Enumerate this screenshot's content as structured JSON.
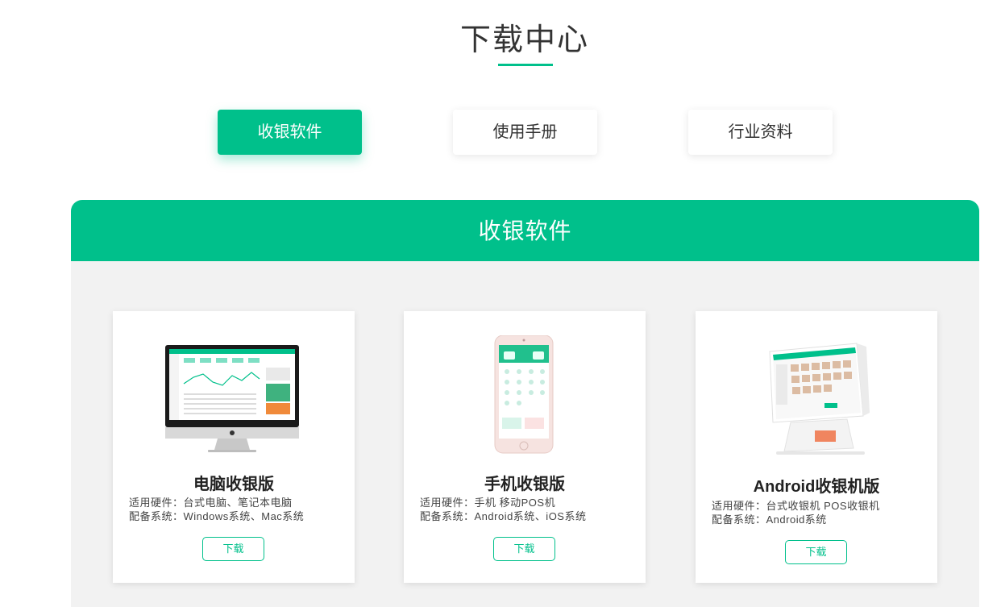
{
  "page_title": "下载中心",
  "tabs": [
    {
      "label": "收银软件",
      "active": true
    },
    {
      "label": "使用手册",
      "active": false
    },
    {
      "label": "行业资料",
      "active": false
    }
  ],
  "panel": {
    "title": "收银软件",
    "cards": [
      {
        "title": "电脑收银版",
        "hardware": "适用硬件：台式电脑、笔记本电脑",
        "system": "配备系统：Windows系统、Mac系统",
        "button": "下载",
        "image": "desktop-computer-illustration"
      },
      {
        "title": "手机收银版",
        "hardware": "适用硬件：手机 移动POS机",
        "system": "配备系统：Android系统、iOS系统",
        "button": "下载",
        "image": "mobile-phone-illustration"
      },
      {
        "title": "Android收银机版",
        "hardware": "适用硬件：台式收银机 POS收银机",
        "system": "配备系统：Android系统",
        "button": "下载",
        "image": "pos-terminal-illustration"
      }
    ]
  },
  "colors": {
    "accent": "#00c08b",
    "panel_bg": "#f2f2f2"
  }
}
